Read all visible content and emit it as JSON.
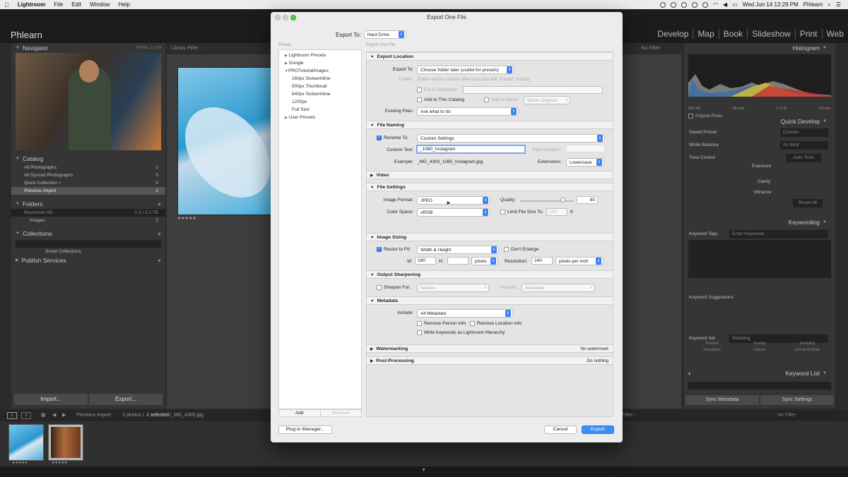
{
  "menubar": {
    "apple": "",
    "items": [
      "Lightroom",
      "File",
      "Edit",
      "Window",
      "Help"
    ],
    "clock": "Wed Jun 14  12:29 PM",
    "user": "Phlearn"
  },
  "lr": {
    "identity": "Phlearn",
    "modules": [
      "Develop",
      "Map",
      "Book",
      "Slideshow",
      "Print",
      "Web"
    ]
  },
  "left": {
    "navigator": "Navigator",
    "nav_opts": "FIT   FILL   1:1   1:8",
    "catalog": "Catalog",
    "catalog_items": [
      {
        "label": "All Photographs",
        "count": "2"
      },
      {
        "label": "All Synced Photographs",
        "count": "0"
      },
      {
        "label": "Quick Collection  +",
        "count": "0"
      },
      {
        "label": "Previous Import",
        "count": "2"
      }
    ],
    "folders": "Folders",
    "drive": "Macintosh HD",
    "drive_size": "1.3 / 3.1 TB",
    "folder_images": "Images",
    "folder_count": "2",
    "collections": "Collections",
    "smart_collections": "Smart Collections",
    "publish": "Publish Services",
    "import_btn": "Import...",
    "export_btn": "Export..."
  },
  "center": {
    "filter": "Library Filter :",
    "no_filter": "No Filter",
    "stars": "★★★★★"
  },
  "right": {
    "histogram": "Histogram",
    "iso": "ISO 50",
    "mm": "35 mm",
    "fstop": "f / 2.8",
    "shutter": "1/3 sec",
    "original_photo": "Original Photo",
    "quick_develop": "Quick Develop",
    "saved_preset": "Saved Preset",
    "saved_preset_val": "Custom",
    "white_balance": "White Balance",
    "white_balance_val": "As Shot",
    "tone_control": "Tone Control",
    "auto_tone": "Auto Tone",
    "exposure": "Exposure",
    "clarity": "Clarity",
    "vibrance": "Vibrance",
    "reset_all": "Reset All",
    "keywording": "Keywording",
    "keyword_tags": "Keyword Tags",
    "enter_keywords": "Enter Keywords",
    "keyword_suggestions": "Keyword Suggestions",
    "keyword_set": "Keyword Set",
    "keyword_set_val": "Wedding",
    "set_words": [
      "Portrait",
      "Family",
      "Wedding",
      "Reception",
      "Dance",
      "Group Portrait"
    ],
    "keyword_list": "Keyword List",
    "sync_metadata": "Sync Metadata",
    "sync_settings": "Sync Settings"
  },
  "bottom": {
    "source": "Previous Import",
    "count": "2 photos /",
    "selected": "1 selected",
    "file": "/_MG_4300.jpg",
    "filter": "Filter :",
    "no_filter": "No Filter",
    "stars": "★★★★★"
  },
  "dialog": {
    "title": "Export One File",
    "export_to_label": "Export To:",
    "export_to_value": "Hard Drive",
    "preset_label": "Preset:",
    "subtitle": "Export One File",
    "presets": [
      {
        "label": "Lightroom Presets",
        "level": 0,
        "arrow": "▶"
      },
      {
        "label": "Google",
        "level": 0,
        "arrow": "▶"
      },
      {
        "label": "PROTutorialImages",
        "level": 0,
        "arrow": "▼"
      },
      {
        "label": "160px SixteenNine",
        "level": 1,
        "arrow": ""
      },
      {
        "label": "500px Thumbnail",
        "level": 1,
        "arrow": ""
      },
      {
        "label": "640px SixteenNine",
        "level": 1,
        "arrow": ""
      },
      {
        "label": "1200px",
        "level": 1,
        "arrow": ""
      },
      {
        "label": "Full Size",
        "level": 1,
        "arrow": ""
      },
      {
        "label": "User Presets",
        "level": 0,
        "arrow": "▶"
      }
    ],
    "add": "Add",
    "remove": "Remove",
    "export_location": {
      "title": "Export Location",
      "export_to_label": "Export To:",
      "export_to_value": "Choose folder later (useful for presets)",
      "folder_label": "Folder:",
      "folder_value": "(folder will be chosen after you click the \"Export\" button)",
      "subfolder": "Put in Subfolder:",
      "add_catalog": "Add to This Catalog",
      "add_stack": "Add to Stack:",
      "below_original": "Below Original",
      "existing_label": "Existing Files:",
      "existing_value": "Ask what to do"
    },
    "file_naming": {
      "title": "File Naming",
      "rename_to": "Rename To:",
      "rename_value": "Custom Settings",
      "custom_text_label": "Custom Text:",
      "custom_text_value": "_1080_Instagram",
      "start_number": "Start Number:",
      "example_label": "Example:",
      "example_value": "_MG_4300_1080_Instagram.jpg",
      "extensions_label": "Extensions:",
      "extensions_value": "Lowercase"
    },
    "video": {
      "title": "Video"
    },
    "file_settings": {
      "title": "File Settings",
      "format_label": "Image Format:",
      "format_value": "JPEG",
      "quality_label": "Quality:",
      "quality_value": "80",
      "quality_fraction": 0.8,
      "colorspace_label": "Color Space:",
      "colorspace_value": "sRGB",
      "limit_label": "Limit File Size To:",
      "limit_value": "100",
      "limit_unit": "K"
    },
    "image_sizing": {
      "title": "Image Sizing",
      "resize_label": "Resize to Fit:",
      "resize_value": "Width & Height",
      "dont_enlarge": "Don't Enlarge",
      "w_label": "W:",
      "w_value": "160",
      "h_label": "H:",
      "h_value": "",
      "units": "pixels",
      "resolution_label": "Resolution:",
      "resolution_value": "240",
      "res_units": "pixels per inch"
    },
    "output_sharpening": {
      "title": "Output Sharpening",
      "sharpen_label": "Sharpen For:",
      "sharpen_value": "Screen",
      "amount_label": "Amount:",
      "amount_value": "Standard"
    },
    "metadata": {
      "title": "Metadata",
      "include_label": "Include:",
      "include_value": "All Metadata",
      "remove_person": "Remove Person Info",
      "remove_location": "Remove Location Info",
      "write_keywords": "Write Keywords as Lightroom Hierarchy"
    },
    "watermarking": {
      "title": "Watermarking",
      "value": "No watermark"
    },
    "post_processing": {
      "title": "Post-Processing",
      "value": "Do nothing"
    },
    "plugin_manager": "Plug-in Manager...",
    "cancel": "Cancel",
    "export": "Export"
  }
}
